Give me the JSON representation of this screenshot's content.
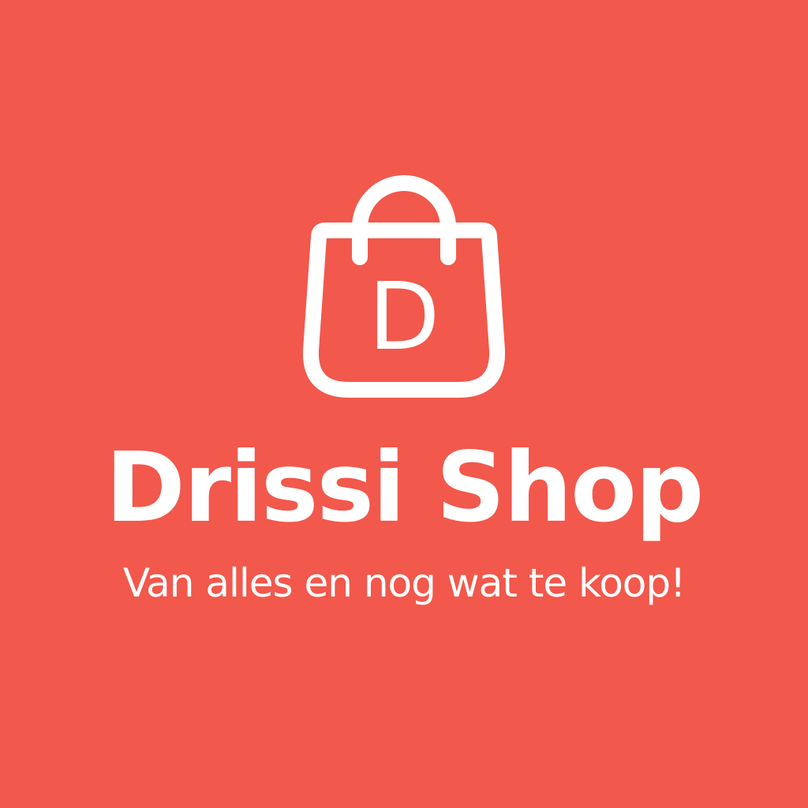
{
  "background_color": "#F2584C",
  "foreground_color": "#FFFFFF",
  "logo": {
    "icon": "shopping-bag-icon",
    "monogram": "D"
  },
  "brand": {
    "name": "Drissi Shop",
    "tagline": "Van alles en nog wat te koop!"
  }
}
